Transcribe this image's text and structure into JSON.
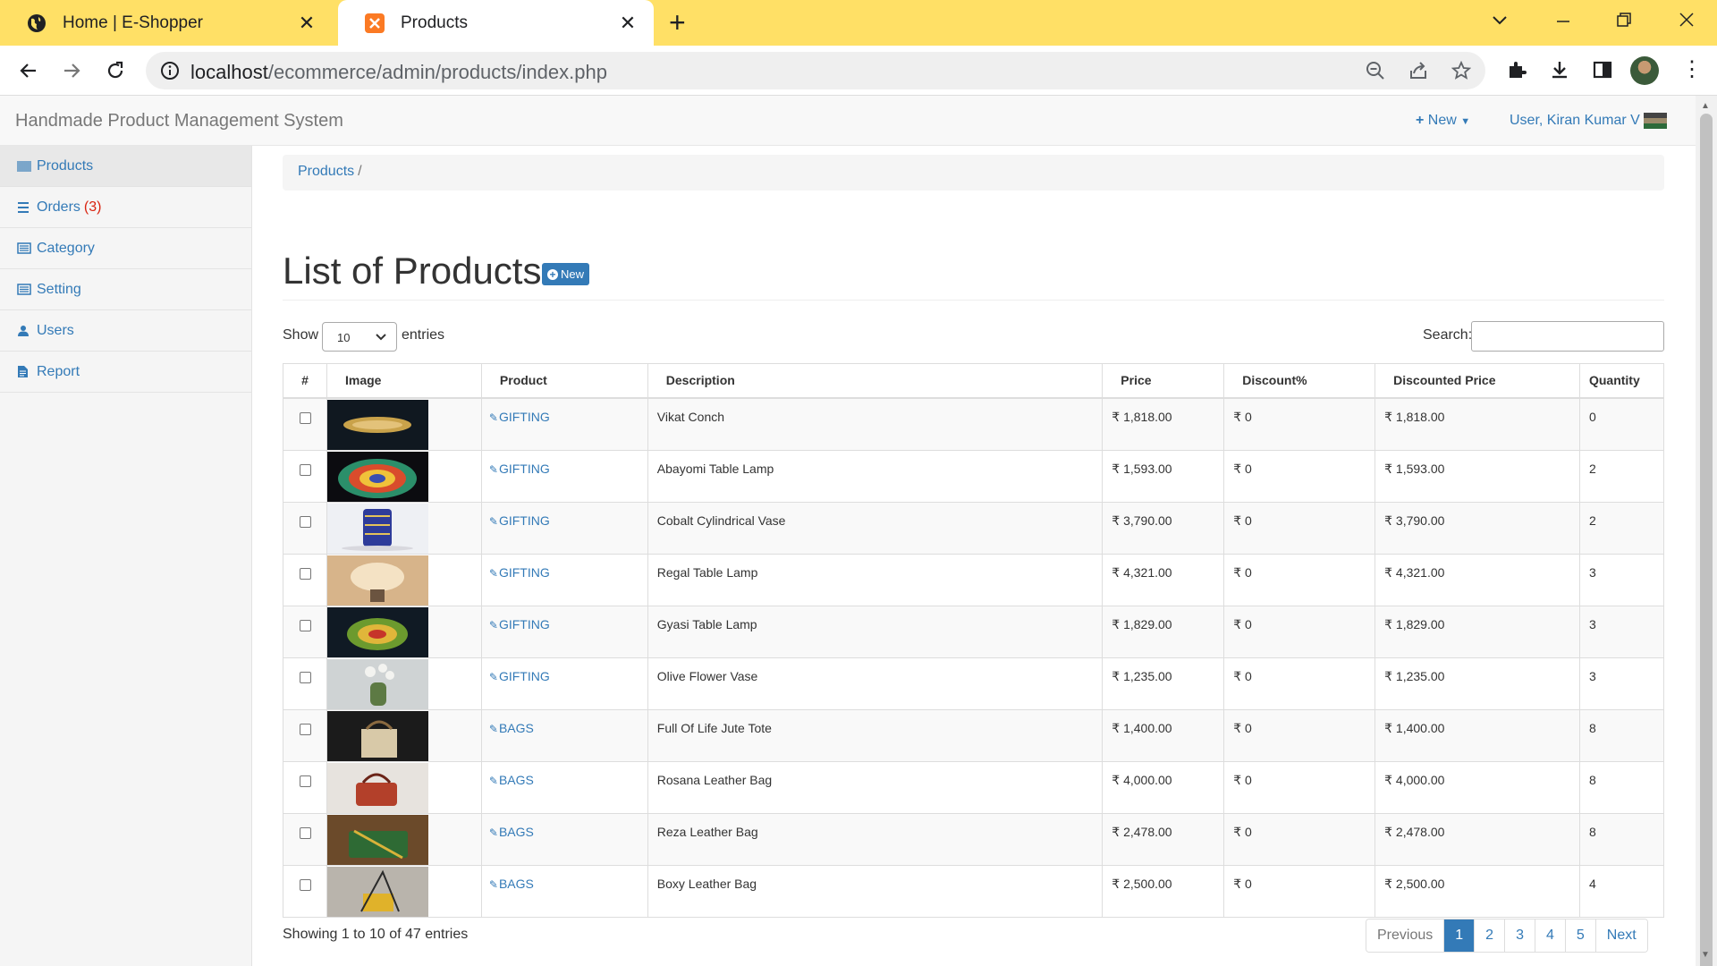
{
  "browser": {
    "tabs": [
      {
        "title": "Home | E-Shopper",
        "active": false
      },
      {
        "title": "Products",
        "active": true
      }
    ],
    "url_host": "localhost",
    "url_path": "/ecommerce/admin/products/index.php"
  },
  "navbar": {
    "brand": "Handmade Product Management System",
    "new_label": "New",
    "user_label": "User, Kiran Kumar V"
  },
  "sidebar": {
    "items": [
      {
        "label": "Products",
        "icon": "barcode-icon",
        "active": true
      },
      {
        "label": "Orders",
        "badge": "(3)",
        "icon": "list-icon"
      },
      {
        "label": "Category",
        "icon": "list-alt-icon"
      },
      {
        "label": "Setting",
        "icon": "list-alt-icon"
      },
      {
        "label": "Users",
        "icon": "user-icon"
      },
      {
        "label": "Report",
        "icon": "file-icon"
      }
    ]
  },
  "breadcrumb": {
    "item": "Products",
    "sep": "/"
  },
  "page": {
    "title": "List of Products",
    "new_button": "New"
  },
  "table_controls": {
    "show_label": "Show",
    "page_size": "10",
    "entries_label": "entries",
    "search_label": "Search:",
    "search_value": ""
  },
  "table": {
    "headers": [
      "#",
      "Image",
      "Product",
      "Description",
      "Price",
      "Discount%",
      "Discounted Price",
      "Quantity"
    ],
    "rows": [
      {
        "category": "GIFTING",
        "description": "Vikat Conch",
        "price": "₹ 1,818.00",
        "discount": "₹ 0",
        "discounted_price": "₹ 1,818.00",
        "quantity": "0",
        "image": "conch"
      },
      {
        "category": "GIFTING",
        "description": "Abayomi Table Lamp",
        "price": "₹ 1,593.00",
        "discount": "₹ 0",
        "discounted_price": "₹ 1,593.00",
        "quantity": "2",
        "image": "lamp-colorful"
      },
      {
        "category": "GIFTING",
        "description": "Cobalt Cylindrical Vase",
        "price": "₹ 3,790.00",
        "discount": "₹ 0",
        "discounted_price": "₹ 3,790.00",
        "quantity": "2",
        "image": "vase-blue"
      },
      {
        "category": "GIFTING",
        "description": "Regal Table Lamp",
        "price": "₹ 4,321.00",
        "discount": "₹ 0",
        "discounted_price": "₹ 4,321.00",
        "quantity": "3",
        "image": "lamp-warm"
      },
      {
        "category": "GIFTING",
        "description": "Gyasi Table Lamp",
        "price": "₹ 1,829.00",
        "discount": "₹ 0",
        "discounted_price": "₹ 1,829.00",
        "quantity": "3",
        "image": "lamp-green"
      },
      {
        "category": "GIFTING",
        "description": "Olive Flower Vase",
        "price": "₹ 1,235.00",
        "discount": "₹ 0",
        "discounted_price": "₹ 1,235.00",
        "quantity": "3",
        "image": "vase-olive"
      },
      {
        "category": "BAGS",
        "description": "Full Of Life Jute Tote",
        "price": "₹ 1,400.00",
        "discount": "₹ 0",
        "discounted_price": "₹ 1,400.00",
        "quantity": "8",
        "image": "tote"
      },
      {
        "category": "BAGS",
        "description": "Rosana Leather Bag",
        "price": "₹ 4,000.00",
        "discount": "₹ 0",
        "discounted_price": "₹ 4,000.00",
        "quantity": "8",
        "image": "bag-red"
      },
      {
        "category": "BAGS",
        "description": "Reza Leather Bag",
        "price": "₹ 2,478.00",
        "discount": "₹ 0",
        "discounted_price": "₹ 2,478.00",
        "quantity": "8",
        "image": "bag-green"
      },
      {
        "category": "BAGS",
        "description": "Boxy Leather Bag",
        "price": "₹ 2,500.00",
        "discount": "₹ 0",
        "discounted_price": "₹ 2,500.00",
        "quantity": "4",
        "image": "bag-yellow"
      }
    ]
  },
  "footer": {
    "info": "Showing 1 to 10 of 47 entries",
    "pagination": [
      "Previous",
      "1",
      "2",
      "3",
      "4",
      "5",
      "Next"
    ],
    "current_page": "1"
  },
  "colors": {
    "tabbar": "#ffe066",
    "link": "#337ab7",
    "badge": "#d9230f"
  }
}
